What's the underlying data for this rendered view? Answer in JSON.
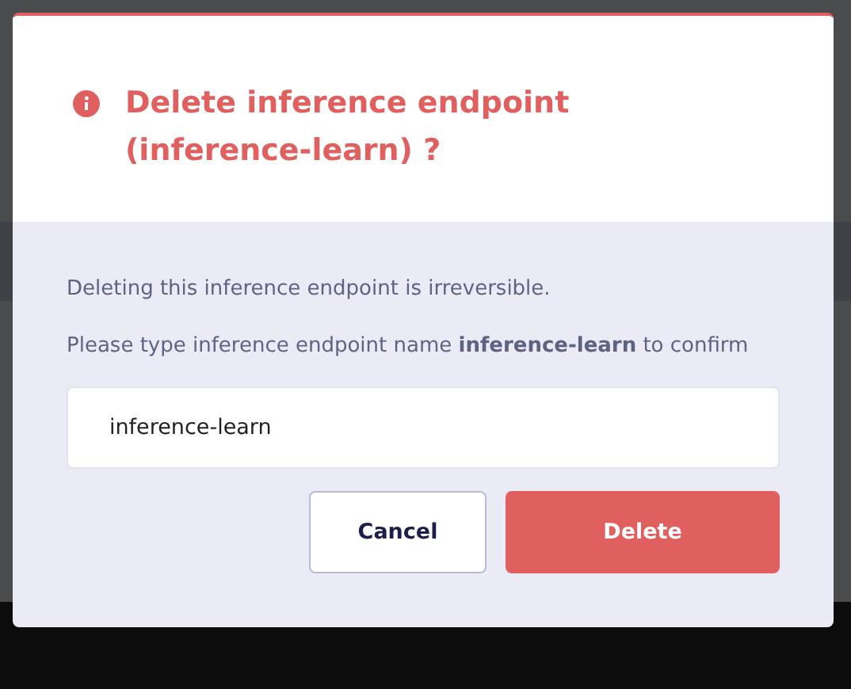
{
  "dialog": {
    "title": "Delete inference endpoint (inference-learn) ?",
    "warning": "Deleting this inference endpoint is irreversible.",
    "instruction": "Please type inference endpoint name **inference-learn** to confirm",
    "input": {
      "value": "inference-learn"
    },
    "buttons": [
      {
        "label": "Cancel",
        "kind": "secondary"
      },
      {
        "label": "Delete",
        "kind": "danger"
      }
    ]
  }
}
